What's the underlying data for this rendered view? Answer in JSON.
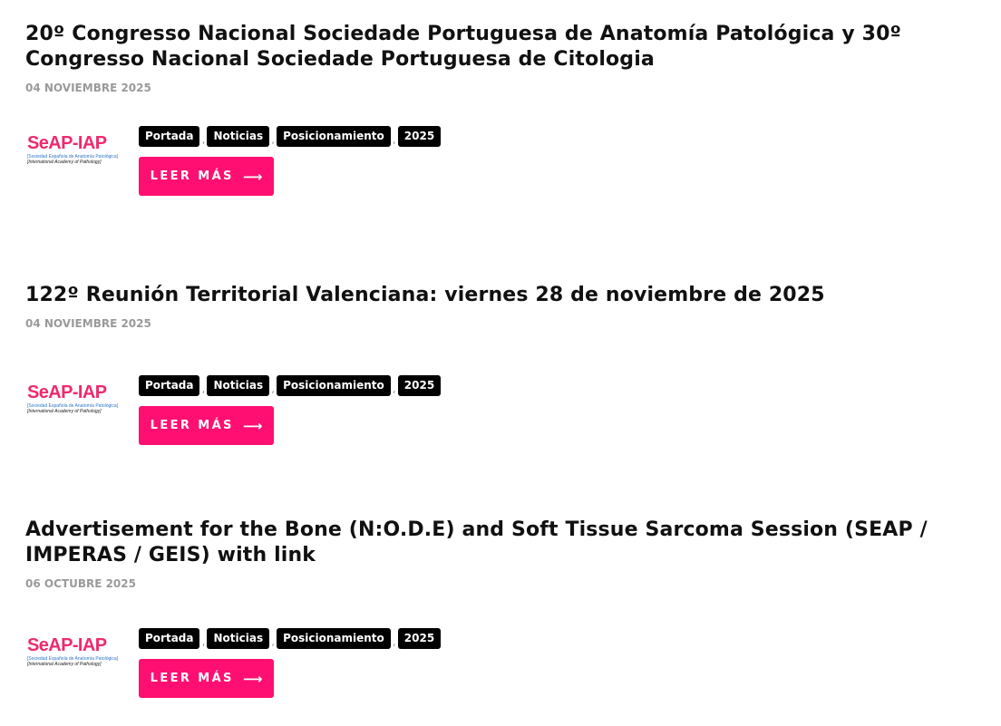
{
  "posts": [
    {
      "title": "20º Congresso Nacional Sociedade Portuguesa de Anatomía Patológica y 30º Congresso Nacional Sociedade Portuguesa de Citologia",
      "date": "04 NOVIEMBRE 2025",
      "logo": {
        "main": "SeAP-IAP",
        "line1": "[Sociedad Española de Anatomía Patológica]",
        "line2": "[International Academy of Pathology]"
      },
      "tags": [
        "Portada",
        "Noticias",
        "Posicionamiento",
        "2025"
      ],
      "read_more": "LEER MÁS",
      "arrow": "⟶"
    },
    {
      "title": "122º Reunión Territorial Valenciana: viernes 28 de noviembre de 2025",
      "date": "04 NOVIEMBRE 2025",
      "logo": {
        "main": "SeAP-IAP",
        "line1": "[Sociedad Española de Anatomía Patológica]",
        "line2": "[International Academy of Pathology]"
      },
      "tags": [
        "Portada",
        "Noticias",
        "Posicionamiento",
        "2025"
      ],
      "read_more": "LEER MÁS",
      "arrow": "⟶"
    },
    {
      "title": "Advertisement for the Bone (N:O.D.E) and Soft Tissue Sarcoma Session (SEAP / IMPERAS / GEIS) with link",
      "date": "06 OCTUBRE 2025",
      "logo": {
        "main": "SeAP-IAP",
        "line1": "[Sociedad Española de Anatomía Patológica]",
        "line2": "[International Academy of Pathology]"
      },
      "tags": [
        "Portada",
        "Noticias",
        "Posicionamiento",
        "2025"
      ],
      "read_more": "LEER MÁS",
      "arrow": "⟶"
    }
  ],
  "tag_separator": ",",
  "colors": {
    "accent": "#ff0f72",
    "logo_pink": "#ee2a6e",
    "logo_blue": "#2f76c9",
    "date_gray": "#9a9a9a",
    "tag_bg": "#000000"
  }
}
